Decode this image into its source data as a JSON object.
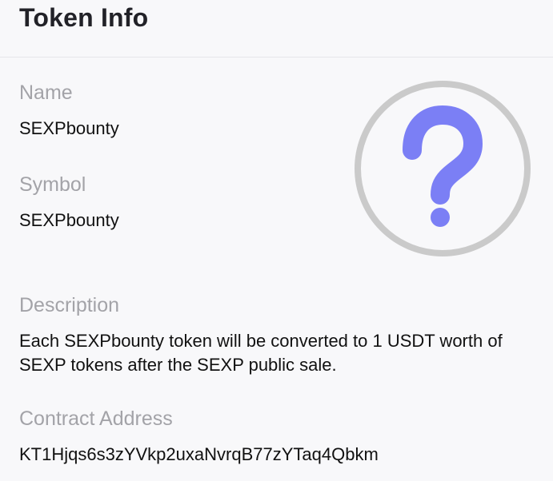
{
  "header": {
    "title": "Token Info"
  },
  "token": {
    "name_label": "Name",
    "name": "SEXPbounty",
    "symbol_label": "Symbol",
    "symbol": "SEXPbounty",
    "description_label": "Description",
    "description": "Each SEXPbounty token will be converted to 1 USDT worth of SEXP tokens after the SEXP public sale.",
    "contract_label": "Contract Address",
    "contract_address": "KT1Hjqs6s3zYVkp2uxaNvrqB77zYTaq4Qbkm"
  },
  "image": {
    "icon": "question-mark-icon",
    "ring_color": "#cacaca",
    "glyph_color": "#7b7ff5"
  }
}
